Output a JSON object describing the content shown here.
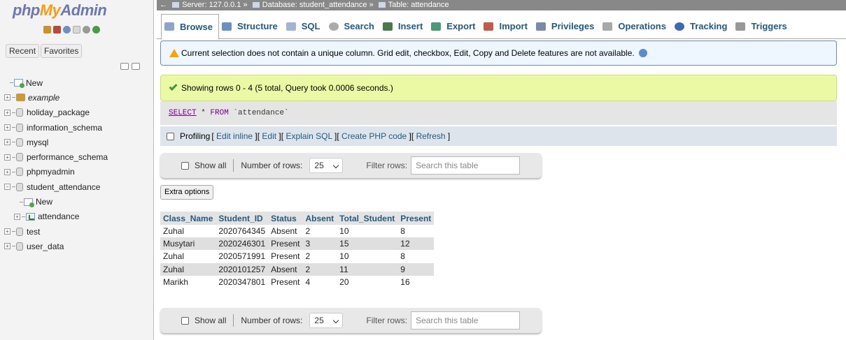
{
  "sidebar": {
    "logo_php": "php",
    "logo_my": "My",
    "logo_admin": "Admin",
    "recent_label": "Recent",
    "favorites_label": "Favorites",
    "tree": [
      {
        "label": "New",
        "kind": "new",
        "level": 0
      },
      {
        "label": "example",
        "kind": "package",
        "level": 0,
        "italic": true
      },
      {
        "label": "holiday_package",
        "kind": "db",
        "level": 0
      },
      {
        "label": "information_schema",
        "kind": "db",
        "level": 0
      },
      {
        "label": "mysql",
        "kind": "db",
        "level": 0
      },
      {
        "label": "performance_schema",
        "kind": "db",
        "level": 0
      },
      {
        "label": "phpmyadmin",
        "kind": "db",
        "level": 0
      },
      {
        "label": "student_attendance",
        "kind": "db",
        "level": 0,
        "expanded": true
      },
      {
        "label": "New",
        "kind": "new",
        "level": 1
      },
      {
        "label": "attendance",
        "kind": "table",
        "level": 1,
        "active": true
      },
      {
        "label": "test",
        "kind": "db",
        "level": 0
      },
      {
        "label": "user_data",
        "kind": "db",
        "level": 0
      }
    ]
  },
  "breadcrumb": {
    "server": "Server: 127.0.0.1",
    "database": "Database: student_attendance",
    "table": "Table: attendance",
    "separator": "»"
  },
  "tabs": [
    {
      "label": "Browse",
      "icon": "ti-browse",
      "active": true
    },
    {
      "label": "Structure",
      "icon": "ti-struct"
    },
    {
      "label": "SQL",
      "icon": "ti-sql"
    },
    {
      "label": "Search",
      "icon": "ti-search"
    },
    {
      "label": "Insert",
      "icon": "ti-insert"
    },
    {
      "label": "Export",
      "icon": "ti-export"
    },
    {
      "label": "Import",
      "icon": "ti-import"
    },
    {
      "label": "Privileges",
      "icon": "ti-priv"
    },
    {
      "label": "Operations",
      "icon": "ti-ops"
    },
    {
      "label": "Tracking",
      "icon": "ti-track"
    },
    {
      "label": "Triggers",
      "icon": "ti-trig"
    }
  ],
  "warning": {
    "text": "Current selection does not contain a unique column. Grid edit, checkbox, Edit, Copy and Delete features are not available."
  },
  "success": {
    "text": "Showing rows 0 - 4 (5 total, Query took 0.0006 seconds.)"
  },
  "sql": {
    "select": "SELECT",
    "star": " * ",
    "from": "FROM",
    "table": " `attendance`"
  },
  "profiling": {
    "label": "Profiling",
    "links": [
      "Edit inline",
      "Edit",
      "Explain SQL",
      "Create PHP code",
      "Refresh"
    ]
  },
  "nav": {
    "show_all": "Show all",
    "num_rows_label": "Number of rows:",
    "num_rows_value": "25",
    "filter_label": "Filter rows:",
    "search_placeholder": "Search this table"
  },
  "extra_options": "Extra options",
  "table": {
    "columns": [
      "Class_Name",
      "Student_ID",
      "Status",
      "Absent",
      "Total_Student",
      "Present"
    ],
    "rows": [
      [
        "Zuhal",
        "2020764345",
        "Absent",
        "2",
        "10",
        "8"
      ],
      [
        "Musytari",
        "2020246301",
        "Present",
        "3",
        "15",
        "12"
      ],
      [
        "Zuhal",
        "2020571991",
        "Present",
        "2",
        "10",
        "8"
      ],
      [
        "Zuhal",
        "2020101257",
        "Absent",
        "2",
        "11",
        "9"
      ],
      [
        "Marikh",
        "2020347801",
        "Present",
        "4",
        "20",
        "16"
      ]
    ]
  }
}
